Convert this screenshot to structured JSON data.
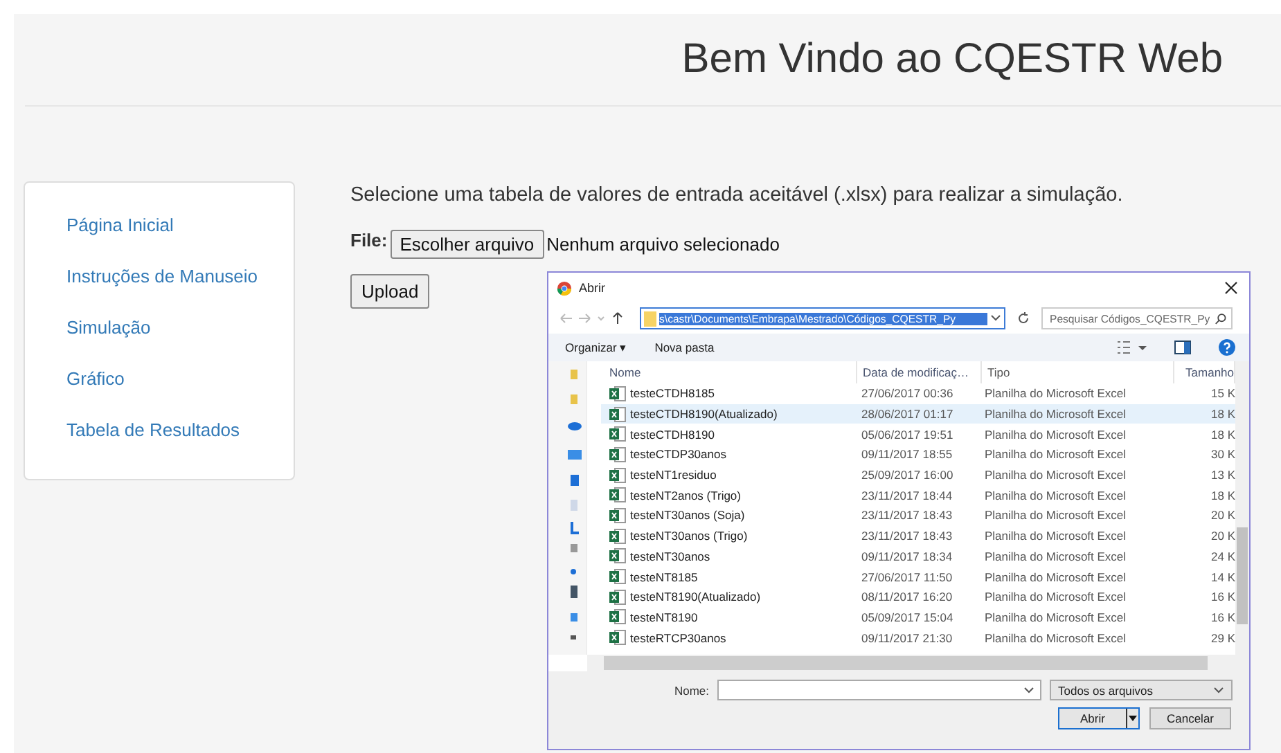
{
  "header": {
    "title": "Bem Vindo ao CQESTR Web"
  },
  "sidebar": {
    "items": [
      {
        "label": "Página Inicial"
      },
      {
        "label": "Instruções de Manuseio"
      },
      {
        "label": "Simulação"
      },
      {
        "label": "Gráfico"
      },
      {
        "label": "Tabela de Resultados"
      }
    ]
  },
  "content": {
    "instruction": "Selecione uma tabela de valores de entrada aceitável (.xlsx) para realizar a simulação.",
    "file_label": "File:",
    "choose_button": "Escolher arquivo",
    "file_status": "Nenhum arquivo selecionado",
    "upload_button": "Upload"
  },
  "dialog": {
    "title": "Abrir",
    "address": "s\\castr\\Documents\\Embrapa\\Mestrado\\Códigos_CQESTR_Py",
    "search_placeholder": "Pesquisar Códigos_CQESTR_Py",
    "toolbar": [
      "Organizar ▾",
      "Nova pasta"
    ],
    "columns": [
      "Nome",
      "Data de modificaç…",
      "Tipo",
      "Tamanho"
    ],
    "rows": [
      {
        "name": "testeCTDH8185",
        "date": "27/06/2017 00:36",
        "type": "Planilha do Microsoft Excel",
        "size": "15 K",
        "selected": false
      },
      {
        "name": "testeCTDH8190(Atualizado)",
        "date": "28/06/2017 01:17",
        "type": "Planilha do Microsoft Excel",
        "size": "18 K",
        "selected": true
      },
      {
        "name": "testeCTDH8190",
        "date": "05/06/2017 19:51",
        "type": "Planilha do Microsoft Excel",
        "size": "18 K",
        "selected": false
      },
      {
        "name": "testeCTDP30anos",
        "date": "09/11/2017 18:55",
        "type": "Planilha do Microsoft Excel",
        "size": "30 K",
        "selected": false
      },
      {
        "name": "testeNT1residuo",
        "date": "25/09/2017 16:00",
        "type": "Planilha do Microsoft Excel",
        "size": "13 K",
        "selected": false
      },
      {
        "name": "testeNT2anos (Trigo)",
        "date": "23/11/2017 18:44",
        "type": "Planilha do Microsoft Excel",
        "size": "18 K",
        "selected": false
      },
      {
        "name": "testeNT30anos (Soja)",
        "date": "23/11/2017 18:43",
        "type": "Planilha do Microsoft Excel",
        "size": "20 K",
        "selected": false
      },
      {
        "name": "testeNT30anos (Trigo)",
        "date": "23/11/2017 18:43",
        "type": "Planilha do Microsoft Excel",
        "size": "20 K",
        "selected": false
      },
      {
        "name": "testeNT30anos",
        "date": "09/11/2017 18:34",
        "type": "Planilha do Microsoft Excel",
        "size": "24 K",
        "selected": false
      },
      {
        "name": "testeNT8185",
        "date": "27/06/2017 11:50",
        "type": "Planilha do Microsoft Excel",
        "size": "14 K",
        "selected": false
      },
      {
        "name": "testeNT8190(Atualizado)",
        "date": "08/11/2017 16:20",
        "type": "Planilha do Microsoft Excel",
        "size": "16 K",
        "selected": false
      },
      {
        "name": "testeNT8190",
        "date": "05/09/2017 15:04",
        "type": "Planilha do Microsoft Excel",
        "size": "16 K",
        "selected": false
      },
      {
        "name": "testeRTCP30anos",
        "date": "09/11/2017 21:30",
        "type": "Planilha do Microsoft Excel",
        "size": "29 K",
        "selected": false
      }
    ],
    "name_label": "Nome:",
    "filter": "Todos os arquivos",
    "open_button": "Abrir",
    "cancel_button": "Cancelar"
  }
}
